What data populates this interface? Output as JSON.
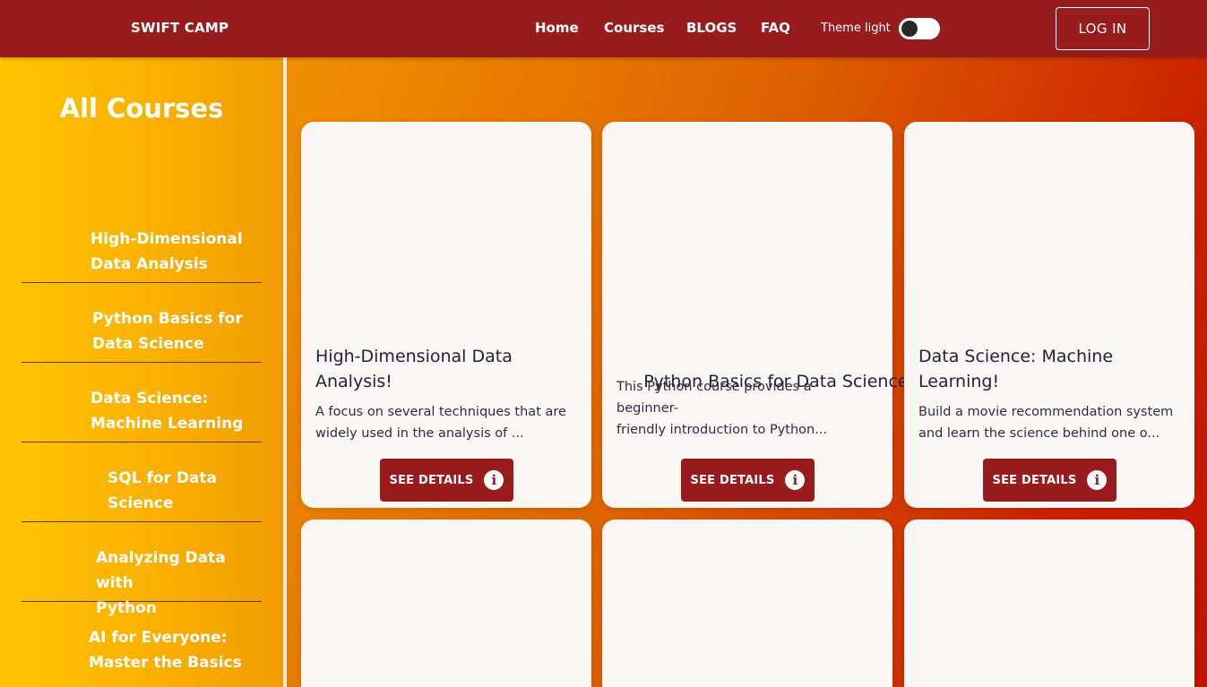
{
  "header": {
    "brand": "SWIFT CAMP",
    "nav": [
      "Home",
      "Courses",
      "BLOGS",
      "FAQ"
    ],
    "theme_label": "Theme light",
    "login_label": "LOG IN"
  },
  "sidebar": {
    "title": "All Courses",
    "items": [
      {
        "line1": "High-Dimensional",
        "line2": "Data Analysis"
      },
      {
        "line1": "Python Basics for",
        "line2": "Data Science"
      },
      {
        "line1": "Data Science:",
        "line2": "Machine Learning"
      },
      {
        "line1": "SQL for Data",
        "line2": "Science"
      },
      {
        "line1": "Analyzing Data with",
        "line2": "Python"
      },
      {
        "line1": "AI for Everyone:",
        "line2": "Master the Basics"
      }
    ]
  },
  "cards": [
    {
      "title_line1": "High-Dimensional Data",
      "title_line2": "Analysis!",
      "desc_line1": "A focus on several techniques that are",
      "desc_line2": "widely used in the analysis of ...",
      "button": "SEE DETAILS"
    },
    {
      "title_line1": " Python Basics for Data Science!",
      "title_line2": "",
      "desc_line1": "This Python course provides a beginner-",
      "desc_line2": "friendly introduction to Python...",
      "button": "SEE DETAILS"
    },
    {
      "title_line1": "Data Science: Machine",
      "title_line2": "Learning!",
      "desc_line1": "Build a movie recommendation system",
      "desc_line2": "and learn the science behind one o...",
      "button": "SEE DETAILS"
    }
  ],
  "colors": {
    "header_bg": "#981b1e",
    "button_bg": "#981b1e",
    "card_bg": "#f9f6f3",
    "sidebar_gradient_start": "#ffc400"
  },
  "icons": {
    "details": "info-circle-icon"
  }
}
